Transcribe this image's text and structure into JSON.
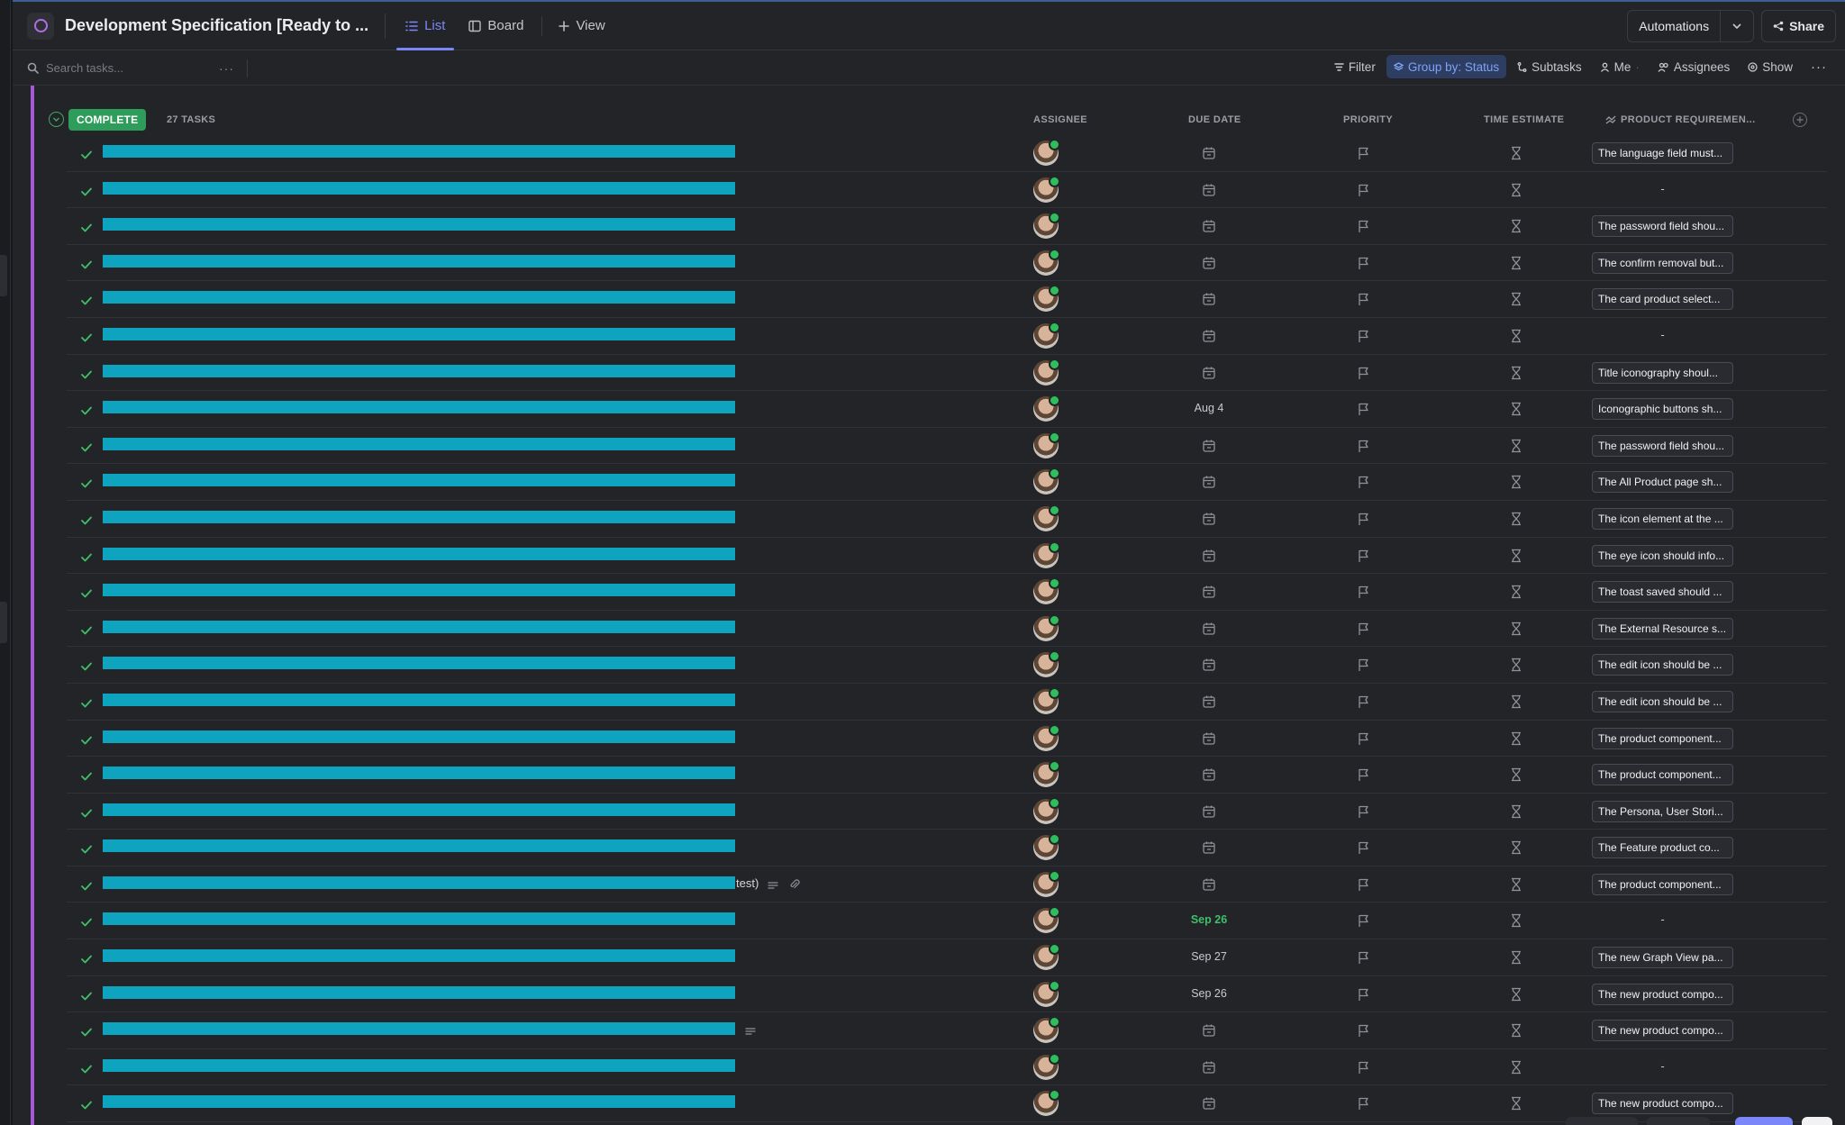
{
  "header": {
    "title": "Development Specification [Ready to ...",
    "views": [
      {
        "label": "List",
        "icon": "list-icon",
        "active": true
      },
      {
        "label": "Board",
        "icon": "board-icon",
        "active": false
      },
      {
        "label": "View",
        "icon": "plus-icon",
        "active": false
      }
    ],
    "automations_label": "Automations",
    "share_label": "Share"
  },
  "toolbar": {
    "search_placeholder": "Search tasks...",
    "filter_label": "Filter",
    "group_by_label": "Group by: Status",
    "subtasks_label": "Subtasks",
    "me_label": "Me",
    "assignees_label": "Assignees",
    "show_label": "Show"
  },
  "group": {
    "status": "COMPLETE",
    "status_color": "#2e9c5a",
    "count_label": "27 TASKS",
    "columns": {
      "assignee": "ASSIGNEE",
      "due_date": "DUE DATE",
      "priority": "PRIORITY",
      "time_estimate": "TIME ESTIMATE",
      "product_requirement": "PRODUCT REQUIREMEN..."
    }
  },
  "tasks": [
    {
      "name_suffix": "",
      "due": "",
      "requirement": "The language field must..."
    },
    {
      "name_suffix": "",
      "due": "",
      "requirement": "-"
    },
    {
      "name_suffix": "",
      "due": "",
      "requirement": "The password field shou..."
    },
    {
      "name_suffix": "",
      "due": "",
      "requirement": "The confirm removal but..."
    },
    {
      "name_suffix": "",
      "due": "",
      "requirement": "The card product select..."
    },
    {
      "name_suffix": "",
      "due": "",
      "requirement": "-"
    },
    {
      "name_suffix": "",
      "due": "",
      "requirement": "Title iconography shoul..."
    },
    {
      "name_suffix": "",
      "due": "Aug 4",
      "requirement": "Iconographic buttons sh..."
    },
    {
      "name_suffix": "",
      "due": "",
      "requirement": "The password field shou..."
    },
    {
      "name_suffix": "",
      "due": "",
      "requirement": "The All Product page sh..."
    },
    {
      "name_suffix": "",
      "due": "",
      "requirement": "The icon element at the ..."
    },
    {
      "name_suffix": "",
      "due": "",
      "requirement": "The eye icon should info..."
    },
    {
      "name_suffix": "",
      "due": "",
      "requirement": "The toast saved should ..."
    },
    {
      "name_suffix": "",
      "due": "",
      "requirement": "The External Resource s..."
    },
    {
      "name_suffix": "",
      "due": "",
      "requirement": "The edit icon should be ..."
    },
    {
      "name_suffix": "",
      "due": "",
      "requirement": "The edit icon should be ..."
    },
    {
      "name_suffix": "",
      "due": "",
      "requirement": "The product component..."
    },
    {
      "name_suffix": "",
      "due": "",
      "requirement": "The product component..."
    },
    {
      "name_suffix": "",
      "due": "",
      "requirement": "The Persona, User Stori..."
    },
    {
      "name_suffix": "",
      "due": "",
      "requirement": "The Feature product co..."
    },
    {
      "name_suffix": "test)",
      "due": "",
      "requirement": "The product component...",
      "has_desc": true,
      "has_attach": true
    },
    {
      "name_suffix": "",
      "due": "Sep 26",
      "due_green": true,
      "requirement": "-"
    },
    {
      "name_suffix": "",
      "due": "Sep 27",
      "requirement": "The new Graph View pa..."
    },
    {
      "name_suffix": "",
      "due": "Sep 26",
      "requirement": "The new product compo..."
    },
    {
      "name_suffix": "",
      "due": "",
      "requirement": "The new product compo...",
      "has_desc": true
    },
    {
      "name_suffix": "",
      "due": "",
      "requirement": "-"
    },
    {
      "name_suffix": "",
      "due": "",
      "requirement": "The new product compo..."
    }
  ],
  "colors": {
    "accent": "#7b87f8",
    "redaction": "#0ea3bf",
    "group_bar": "#a659d4",
    "due_soon": "#3fbf6a"
  }
}
